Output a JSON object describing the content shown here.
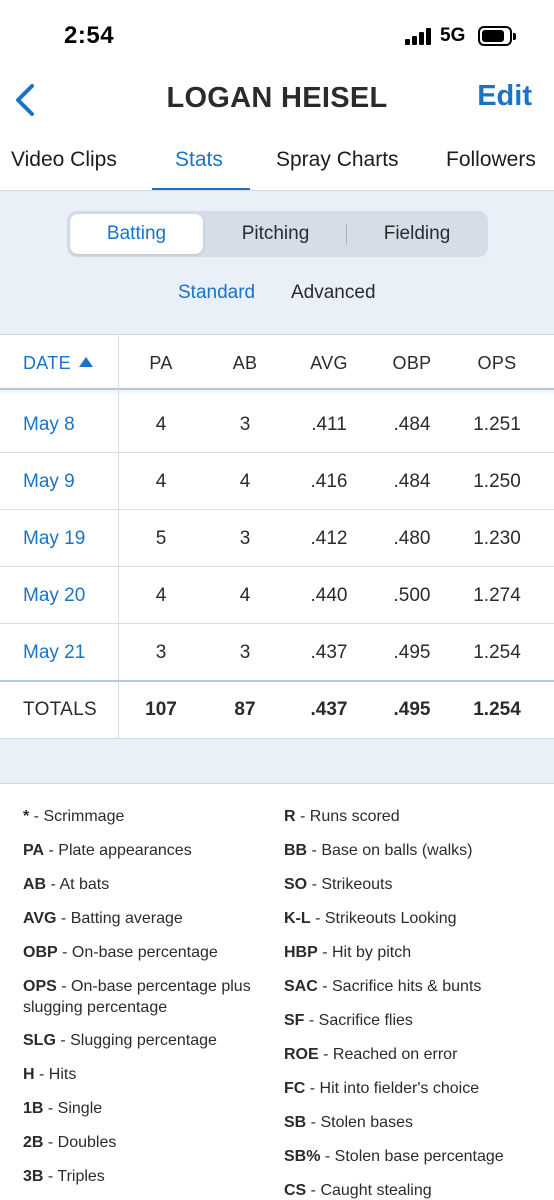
{
  "status_bar": {
    "time": "2:54",
    "network": "5G"
  },
  "nav": {
    "title": "LOGAN HEISEL",
    "edit_label": "Edit"
  },
  "tabs": [
    {
      "label": "Video Clips",
      "active": false
    },
    {
      "label": "Stats",
      "active": true
    },
    {
      "label": "Spray Charts",
      "active": false
    },
    {
      "label": "Followers",
      "active": false
    }
  ],
  "segment": [
    {
      "label": "Batting",
      "active": true
    },
    {
      "label": "Pitching",
      "active": false
    },
    {
      "label": "Fielding",
      "active": false
    }
  ],
  "subtoggle": [
    {
      "label": "Standard",
      "active": true
    },
    {
      "label": "Advanced",
      "active": false
    }
  ],
  "table": {
    "headers": [
      "DATE",
      "PA",
      "AB",
      "AVG",
      "OBP",
      "OPS"
    ],
    "rows": [
      [
        "May 8",
        "4",
        "3",
        ".411",
        ".484",
        "1.251"
      ],
      [
        "May 9",
        "4",
        "4",
        ".416",
        ".484",
        "1.250"
      ],
      [
        "May 19",
        "5",
        "3",
        ".412",
        ".480",
        "1.230"
      ],
      [
        "May 20",
        "4",
        "4",
        ".440",
        ".500",
        "1.274"
      ],
      [
        "May 21",
        "3",
        "3",
        ".437",
        ".495",
        "1.254"
      ]
    ],
    "totals": [
      "TOTALS",
      "107",
      "87",
      ".437",
      ".495",
      "1.254"
    ]
  },
  "legend": {
    "left": [
      {
        "abbr": "*",
        "desc": " - Scrimmage"
      },
      {
        "abbr": "PA",
        "desc": " - Plate appearances"
      },
      {
        "abbr": "AB",
        "desc": " - At bats"
      },
      {
        "abbr": "AVG",
        "desc": " - Batting average"
      },
      {
        "abbr": "OBP",
        "desc": " - On-base percentage"
      },
      {
        "abbr": "OPS",
        "desc": " - On-base percentage plus slugging percentage"
      },
      {
        "abbr": "SLG",
        "desc": " - Slugging percentage"
      },
      {
        "abbr": "H",
        "desc": " - Hits"
      },
      {
        "abbr": "1B",
        "desc": " - Single"
      },
      {
        "abbr": "2B",
        "desc": " - Doubles"
      },
      {
        "abbr": "3B",
        "desc": " - Triples"
      }
    ],
    "right": [
      {
        "abbr": "R",
        "desc": " - Runs scored"
      },
      {
        "abbr": "BB",
        "desc": " - Base on balls (walks)"
      },
      {
        "abbr": "SO",
        "desc": " - Strikeouts"
      },
      {
        "abbr": "K-L",
        "desc": " - Strikeouts Looking"
      },
      {
        "abbr": "HBP",
        "desc": " - Hit by pitch"
      },
      {
        "abbr": "SAC",
        "desc": " - Sacrifice hits & bunts"
      },
      {
        "abbr": "SF",
        "desc": " - Sacrifice flies"
      },
      {
        "abbr": "ROE",
        "desc": " - Reached on error"
      },
      {
        "abbr": "FC",
        "desc": " - Hit into fielder's choice"
      },
      {
        "abbr": "SB",
        "desc": " - Stolen bases"
      },
      {
        "abbr": "SB%",
        "desc": " - Stolen base percentage"
      },
      {
        "abbr": "CS",
        "desc": " - Caught stealing"
      }
    ]
  },
  "colors": {
    "accent": "#1a73c8",
    "panel": "#eaf0f8",
    "text": "#2b2b2e"
  }
}
